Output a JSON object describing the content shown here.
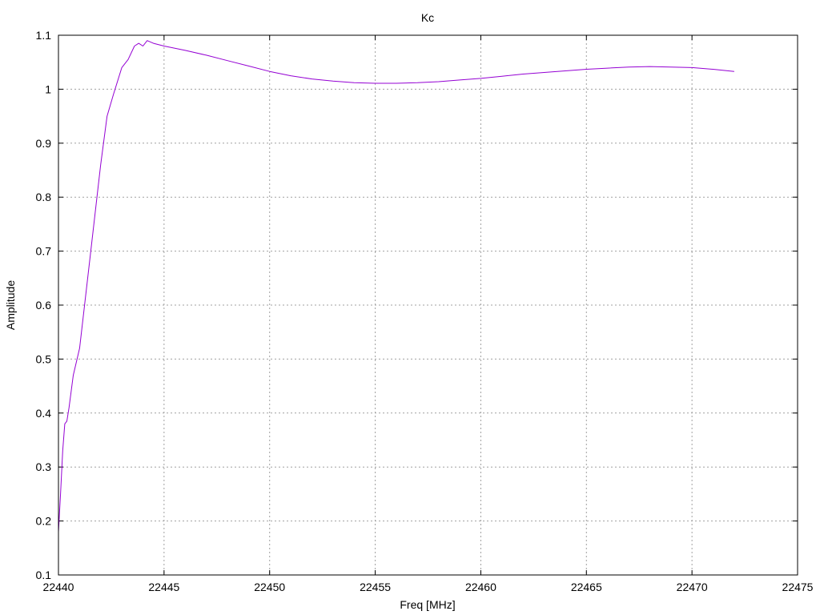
{
  "chart_data": {
    "type": "line",
    "title": "Kc",
    "xlabel": "Freq [MHz]",
    "ylabel": "Amplitude",
    "xlim": [
      22440,
      22475
    ],
    "ylim": [
      0.1,
      1.1
    ],
    "x_ticks": [
      22440,
      22445,
      22450,
      22455,
      22460,
      22465,
      22470,
      22475
    ],
    "y_ticks": [
      0.1,
      0.2,
      0.3,
      0.4,
      0.5,
      0.6,
      0.7,
      0.8,
      0.9,
      1,
      1.1
    ],
    "grid": true,
    "legend": "none",
    "series": [
      {
        "color": "#9400d3",
        "x": [
          22440.0,
          22440.1,
          22440.2,
          22440.3,
          22440.4,
          22440.5,
          22440.7,
          22441.0,
          22441.5,
          22442.0,
          22442.3,
          22442.6,
          22443.0,
          22443.3,
          22443.6,
          22443.8,
          22444.0,
          22444.2,
          22444.5,
          22445.0,
          22446.0,
          22447.0,
          22448.0,
          22449.0,
          22450.0,
          22451.0,
          22452.0,
          22453.0,
          22454.0,
          22455.0,
          22456.0,
          22457.0,
          22458.0,
          22459.0,
          22460.0,
          22461.0,
          22462.0,
          22463.0,
          22464.0,
          22465.0,
          22466.0,
          22467.0,
          22468.0,
          22469.0,
          22470.0,
          22471.0,
          22472.0
        ],
        "y": [
          0.18,
          0.25,
          0.33,
          0.38,
          0.385,
          0.41,
          0.47,
          0.52,
          0.69,
          0.86,
          0.95,
          0.99,
          1.04,
          1.055,
          1.08,
          1.085,
          1.08,
          1.09,
          1.085,
          1.08,
          1.072,
          1.063,
          1.053,
          1.043,
          1.033,
          1.025,
          1.019,
          1.015,
          1.012,
          1.011,
          1.011,
          1.012,
          1.014,
          1.017,
          1.02,
          1.024,
          1.028,
          1.031,
          1.034,
          1.037,
          1.039,
          1.041,
          1.042,
          1.041,
          1.04,
          1.037,
          1.033
        ]
      }
    ]
  }
}
